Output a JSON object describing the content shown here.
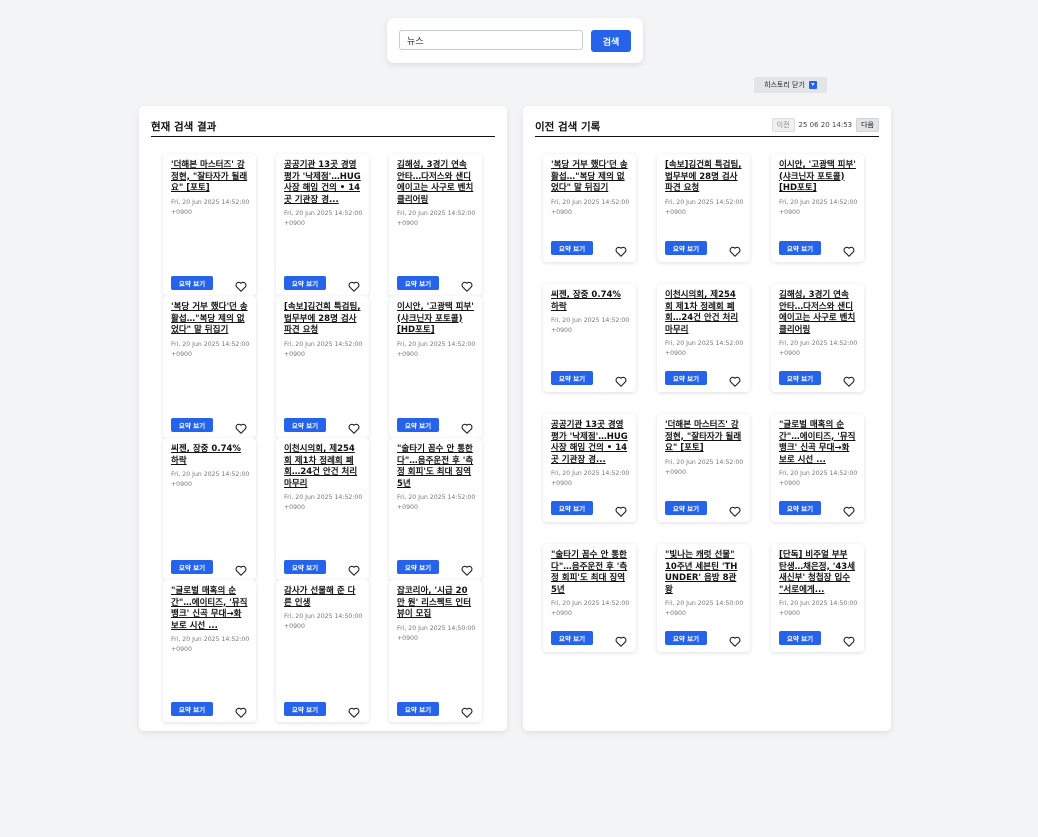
{
  "search": {
    "value": "뉴스",
    "button_label": "검색"
  },
  "history_toggle": {
    "label": "히스토리 닫기",
    "icon": "chevron-down-icon",
    "icon_glyph": "▾"
  },
  "current": {
    "title": "현재 검색 결과",
    "summary_label": "요약 보기",
    "cards": [
      {
        "title": "'더해본 마스터즈' 강정현, \"잘타자가 될래요\" [포토]",
        "date": "Fri, 20 Jun 2025 14:52:00 +0900"
      },
      {
        "title": "공공기관 13곳 경영평가 '낙제점'…HUG 사장 해임 건의 • 14곳 기관장 경...",
        "date": "Fri, 20 Jun 2025 14:52:00 +0900"
      },
      {
        "title": "김해성, 3경기 연속 안타…다저스와 샌디에이고는 사구로 벤치클리어링",
        "date": "Fri, 20 Jun 2025 14:52:00 +0900"
      },
      {
        "title": "'복당 거부 했다'던 송활섭…\"복당 제의 없었다\" 말 뒤집기",
        "date": "Fri, 20 Jun 2025 14:52:00 +0900"
      },
      {
        "title": "[속보]김건희 특검팀, 법무부에 28명 검사 파견 요청",
        "date": "Fri, 20 Jun 2025 14:52:00 +0900"
      },
      {
        "title": "이시안, '고광택 피부' (샤크닌자 포토콜) [HD포토]",
        "date": "Fri, 20 Jun 2025 14:52:00 +0900"
      },
      {
        "title": "씨젠, 장중 0.74% 하락",
        "date": "Fri, 20 Jun 2025 14:52:00 +0900"
      },
      {
        "title": "이천시의회, 제254회 제1차 정례회 폐회…24건 안건 처리 마무리",
        "date": "Fri, 20 Jun 2025 14:52:00 +0900"
      },
      {
        "title": "\"술타기 꼼수 안 통한다\"…음주운전 후 '측정 회피'도 최대 징역 5년",
        "date": "Fri, 20 Jun 2025 14:52:00 +0900"
      },
      {
        "title": "\"글로벌 매혹의 순간\"…에이티즈, '뮤직뱅크' 신곡 무대→화보로 시선 ...",
        "date": "Fri, 20 Jun 2025 14:52:00 +0900"
      },
      {
        "title": "감사가 선물해 준 다른 인생",
        "date": "Fri, 20 Jun 2025 14:50:00 +0900"
      },
      {
        "title": "잡코리아, '시급 20만 원' 리스펙트 인터뷰이 모집",
        "date": "Fri, 20 Jun 2025 14:50:00 +0900"
      }
    ]
  },
  "history": {
    "title": "이전 검색 기록",
    "prev_label": "이전",
    "date": "25 06 20 14:53",
    "next_label": "다음",
    "summary_label": "요약 보기",
    "cards": [
      {
        "title": "'복당 거부 했다'던 송활섭…\"복당 제의 없었다\" 말 뒤집기",
        "date": "Fri, 20 Jun 2025 14:52:00 +0900"
      },
      {
        "title": "[속보]김건희 특검팀, 법무부에 28명 검사 파견 요청",
        "date": "Fri, 20 Jun 2025 14:52:00 +0900"
      },
      {
        "title": "이시안, '고광택 피부' (샤크닌자 포토콜) [HD포토]",
        "date": "Fri, 20 Jun 2025 14:52:00 +0900"
      },
      {
        "title": "씨젠, 장중 0.74% 하락",
        "date": "Fri, 20 Jun 2025 14:52:00 +0900"
      },
      {
        "title": "이천시의회, 제254회 제1차 정례회 폐회…24건 안건 처리 마무리",
        "date": "Fri, 20 Jun 2025 14:52:00 +0900"
      },
      {
        "title": "김해성, 3경기 연속 안타…다저스와 샌디에이고는 사구로 벤치클리어링",
        "date": "Fri, 20 Jun 2025 14:52:00 +0900"
      },
      {
        "title": "공공기관 13곳 경영평가 '낙제점'…HUG 사장 해임 건의 • 14곳 기관장 경...",
        "date": "Fri, 20 Jun 2025 14:52:00 +0900"
      },
      {
        "title": "'더해본 마스터즈' 강정현, \"잘타자가 될래요\" [포토]",
        "date": "Fri, 20 Jun 2025 14:52:00 +0900"
      },
      {
        "title": "\"글로벌 매혹의 순간\"…에이티즈, '뮤직뱅크' 신곡 무대→화보로 시선 ...",
        "date": "Fri, 20 Jun 2025 14:52:00 +0900"
      },
      {
        "title": "\"술타기 꼼수 안 통한다\"…음주운전 후 '측정 회피'도 최대 징역 5년",
        "date": "Fri, 20 Jun 2025 14:52:00 +0900"
      },
      {
        "title": "\"빛나는 캐럿 선물\" 10주년 세븐틴 'THUNDER' 음방 8관왕",
        "date": "Fri, 20 Jun 2025 14:50:00 +0900"
      },
      {
        "title": "[단독] 비주얼 부부 탄생…채은정, '43세 새신부' 청첩장 입수 \"서로에게...",
        "date": "Fri, 20 Jun 2025 14:50:00 +0900"
      }
    ]
  }
}
